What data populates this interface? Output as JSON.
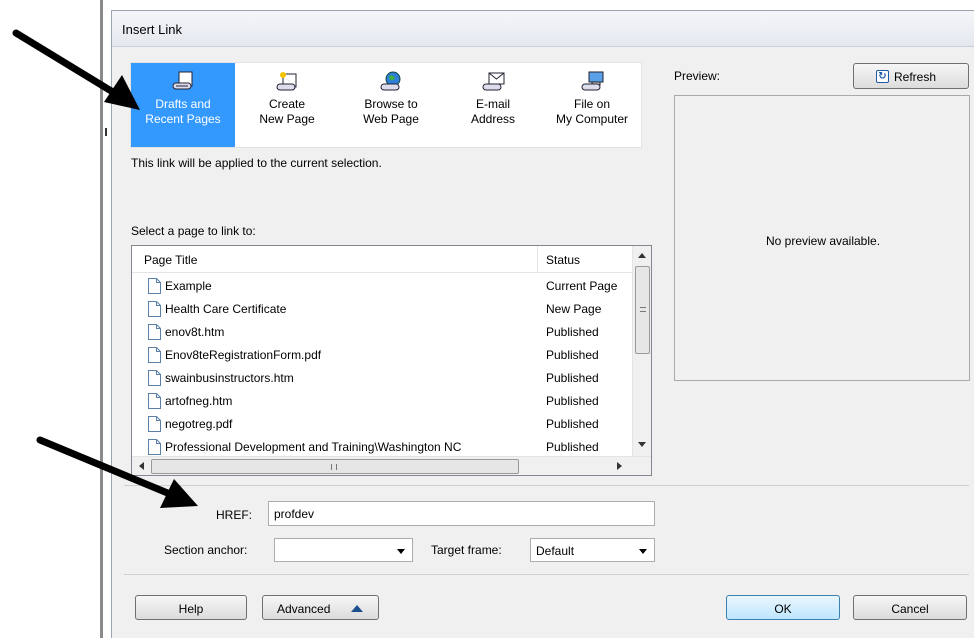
{
  "dialog": {
    "title": "Insert Link",
    "nav": [
      {
        "label": "Drafts and\nRecent Pages",
        "icon": "drafts-link-icon",
        "selected": true
      },
      {
        "label": "Create\nNew Page",
        "icon": "new-page-link-icon",
        "selected": false
      },
      {
        "label": "Browse to\nWeb Page",
        "icon": "globe-link-icon",
        "selected": false
      },
      {
        "label": "E-mail\nAddress",
        "icon": "email-link-icon",
        "selected": false
      },
      {
        "label": "File on\nMy Computer",
        "icon": "computer-link-icon",
        "selected": false
      }
    ],
    "selection_note": "This link will be applied to the current selection.",
    "select_page_label": "Select a page to link to:",
    "list": {
      "columns": [
        "Page Title",
        "Status"
      ],
      "rows": [
        {
          "title": "Example",
          "status": "Current Page"
        },
        {
          "title": "Health Care Certificate",
          "status": "New Page"
        },
        {
          "title": "enov8t.htm",
          "status": "Published"
        },
        {
          "title": "Enov8teRegistrationForm.pdf",
          "status": "Published"
        },
        {
          "title": "swainbusinstructors.htm",
          "status": "Published"
        },
        {
          "title": "artofneg.htm",
          "status": "Published"
        },
        {
          "title": "negotreg.pdf",
          "status": "Published"
        },
        {
          "title": "Professional Development and Training\\Washington NC",
          "status": "Published"
        }
      ]
    },
    "preview": {
      "label": "Preview:",
      "refresh_label": "Refresh",
      "empty_message": "No preview available."
    },
    "href": {
      "label": "HREF:",
      "value": "profdev"
    },
    "section_anchor": {
      "label": "Section anchor:",
      "value": ""
    },
    "target_frame": {
      "label": "Target frame:",
      "value": "Default"
    },
    "buttons": {
      "help": "Help",
      "advanced": "Advanced",
      "ok": "OK",
      "cancel": "Cancel"
    }
  },
  "colors": {
    "selection": "#3399ff",
    "annotation_arrow": "#000000"
  }
}
